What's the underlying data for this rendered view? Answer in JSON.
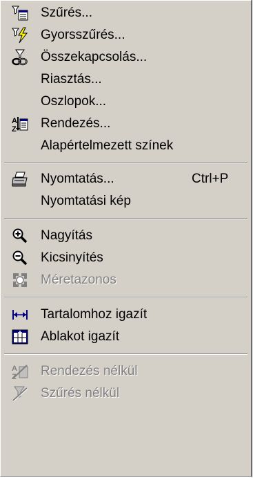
{
  "menu": {
    "items": [
      {
        "label": "Szűrés...",
        "icon": "filter-icon",
        "shortcut": "",
        "disabled": false
      },
      {
        "label": "Gyorsszűrés...",
        "icon": "quick-filter-icon",
        "shortcut": "",
        "disabled": false
      },
      {
        "label": "Összekapcsolás...",
        "icon": "link-icon",
        "shortcut": "",
        "disabled": false
      },
      {
        "label": "Riasztás...",
        "icon": "",
        "shortcut": "",
        "disabled": false
      },
      {
        "label": "Oszlopok...",
        "icon": "",
        "shortcut": "",
        "disabled": false
      },
      {
        "label": "Rendezés...",
        "icon": "sort-icon",
        "shortcut": "",
        "disabled": false
      },
      {
        "label": "Alapértelmezett színek",
        "icon": "",
        "shortcut": "",
        "disabled": false
      },
      {
        "label": "Nyomtatás...",
        "icon": "printer-icon",
        "shortcut": "Ctrl+P",
        "disabled": false
      },
      {
        "label": "Nyomtatási kép",
        "icon": "",
        "shortcut": "",
        "disabled": false
      },
      {
        "label": "Nagyítás",
        "icon": "zoom-in-icon",
        "shortcut": "",
        "disabled": false
      },
      {
        "label": "Kicsinyítés",
        "icon": "zoom-out-icon",
        "shortcut": "",
        "disabled": false
      },
      {
        "label": "Méretazonos",
        "icon": "actual-size-icon",
        "shortcut": "",
        "disabled": true
      },
      {
        "label": "Tartalomhoz igazít",
        "icon": "fit-to-content-icon",
        "shortcut": "",
        "disabled": false
      },
      {
        "label": "Ablakot igazít",
        "icon": "fit-to-window-icon",
        "shortcut": "",
        "disabled": false
      },
      {
        "label": "Rendezés nélkül",
        "icon": "no-sort-icon",
        "shortcut": "",
        "disabled": true
      },
      {
        "label": "Szűrés nélkül",
        "icon": "no-filter-icon",
        "shortcut": "",
        "disabled": true
      }
    ]
  },
  "colors": {
    "menu_bg": "#d4d0c8",
    "disabled_text": "#808080",
    "icon_blue": "#000080",
    "icon_yellow": "#ffff00",
    "icon_teal": "#008080"
  }
}
